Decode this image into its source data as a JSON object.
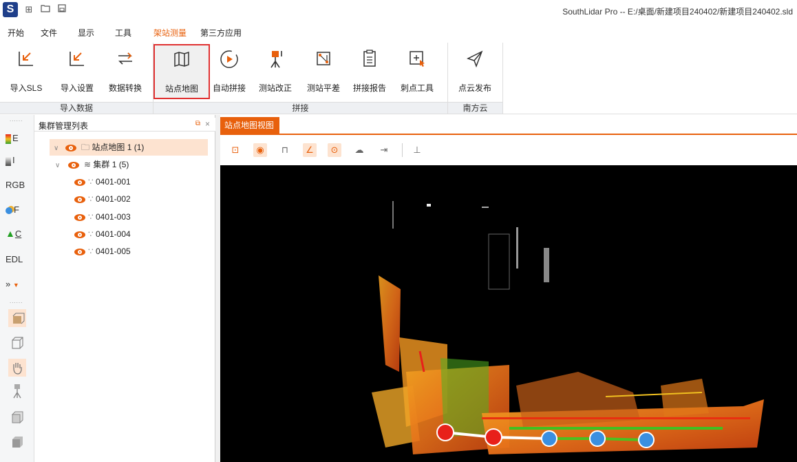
{
  "window": {
    "title": "SouthLidar Pro -- E:/桌面/新建项目240402/新建项目240402.sld"
  },
  "app_logo": "S",
  "quick_access": [
    "new-icon",
    "open-icon",
    "save-icon"
  ],
  "menu": {
    "items": [
      "开始",
      "文件",
      "显示",
      "工具",
      "架站测量",
      "第三方应用"
    ],
    "active": "架站测量"
  },
  "ribbon": {
    "buttons": [
      "导入SLS",
      "导入设置",
      "数据转换",
      "站点地图",
      "自动拼接",
      "测站改正",
      "测站平差",
      "拼接报告",
      "刺点工具",
      "点云发布"
    ],
    "selected": "站点地图",
    "groups": [
      "导入数据",
      "拼接",
      "南方云"
    ]
  },
  "leftbar": {
    "items": [
      "E",
      "I",
      "RGB",
      "F",
      "C",
      "EDL",
      "»"
    ]
  },
  "panel": {
    "title": "集群管理列表",
    "tree": {
      "root": "站点地图 1 (1)",
      "cluster": "集群 1 (5)",
      "stations": [
        "0401-001",
        "0401-002",
        "0401-003",
        "0401-004",
        "0401-005"
      ]
    }
  },
  "view": {
    "tab": "站点地图视图"
  },
  "colors": {
    "accent": "#e8600c",
    "selected_border": "#e03030",
    "station_red": "#e8201a",
    "station_blue": "#3a8fe0"
  }
}
